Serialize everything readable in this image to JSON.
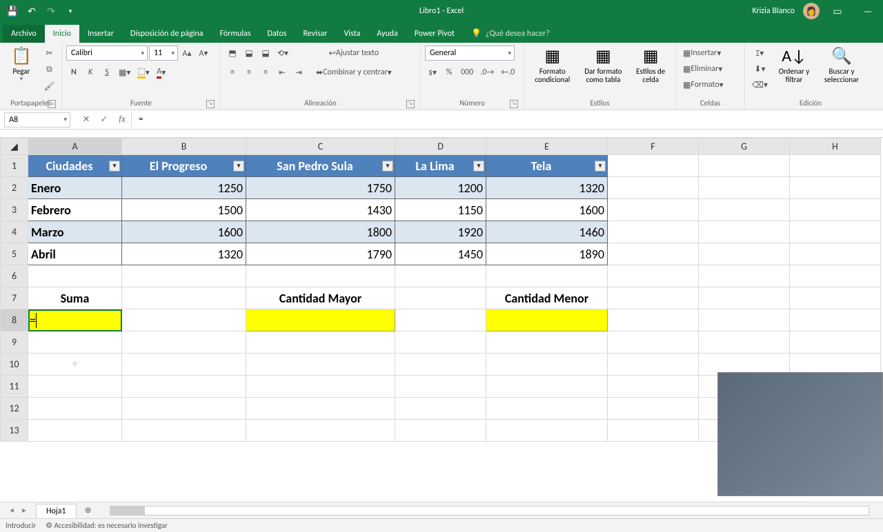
{
  "titlebar": {
    "title": "Libro1 - Excel",
    "user": "Krizia Blanco"
  },
  "tabs": [
    "Archivo",
    "Inicio",
    "Insertar",
    "Disposición de página",
    "Fórmulas",
    "Datos",
    "Revisar",
    "Vista",
    "Ayuda",
    "Power Pivot"
  ],
  "tell_me": "¿Qué desea hacer?",
  "ribbon": {
    "clipboard": {
      "paste": "Pegar",
      "label": "Portapapeles"
    },
    "font": {
      "name": "Calibri",
      "size": "11",
      "label": "Fuente"
    },
    "alignment": {
      "wrap": "Ajustar texto",
      "merge": "Combinar y centrar",
      "label": "Alineación"
    },
    "number": {
      "format": "General",
      "label": "Número"
    },
    "styles": {
      "cond": "Formato condicional",
      "table": "Dar formato como tabla",
      "cell": "Estilos de celda",
      "label": "Estilos"
    },
    "cells": {
      "insert": "Insertar",
      "delete": "Eliminar",
      "format": "Formato",
      "label": "Celdas"
    },
    "editing": {
      "sort": "Ordenar y filtrar",
      "find": "Buscar y seleccionar",
      "label": "Edición"
    }
  },
  "namebox": "A8",
  "formula": "=",
  "columns": [
    "A",
    "B",
    "C",
    "D",
    "E",
    "F",
    "G",
    "H"
  ],
  "rows": [
    "1",
    "2",
    "3",
    "4",
    "5",
    "6",
    "7",
    "8",
    "9",
    "10",
    "11",
    "12",
    "13"
  ],
  "table": {
    "headers": [
      "Ciudades",
      "El Progreso",
      "San Pedro Sula",
      "La Lima",
      "Tela"
    ],
    "data": [
      [
        "Enero",
        "1250",
        "1750",
        "1200",
        "1320"
      ],
      [
        "Febrero",
        "1500",
        "1430",
        "1150",
        "1600"
      ],
      [
        "Marzo",
        "1600",
        "1800",
        "1920",
        "1460"
      ],
      [
        "Abril",
        "1320",
        "1790",
        "1450",
        "1890"
      ]
    ]
  },
  "labels": {
    "suma": "Suma",
    "mayor": "Cantidad Mayor",
    "menor": "Cantidad Menor"
  },
  "active_cell_content": "=",
  "sheet_tab": "Hoja1",
  "status": {
    "mode": "Introducir",
    "acc": "Accesibilidad: es necesario investigar"
  }
}
